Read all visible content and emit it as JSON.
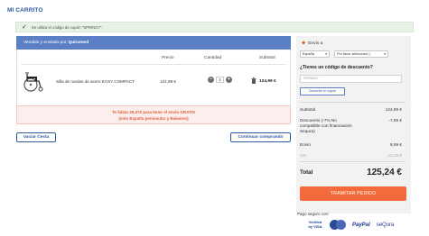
{
  "page": {
    "title": "MI CARRITO"
  },
  "alert": {
    "message": "Se utiliza el código de cupón \"SPRING7\"."
  },
  "cart": {
    "header_prefix": "Vendido y enviado por",
    "seller": "Quirumed",
    "columns": {
      "price": "Precio",
      "quantity": "Cantidad",
      "subtotal": "Subtotal"
    },
    "item": {
      "name": "Silla de ruedas de acero EASY COMPACT",
      "price": "124,99 €",
      "quantity": "1",
      "subtotal": "124,99 €"
    }
  },
  "promo": {
    "line1": "Te faltan 26,37€ para tener el envío GRATIS",
    "line2": "(solo España peninsular y Baleares)"
  },
  "actions": {
    "empty_cart": "Vaciar Cesta",
    "continue_shopping": "Continuar comprando"
  },
  "sidebar": {
    "ship_to": "Envío a",
    "country": "España",
    "region_placeholder": "Por favor seleccione (",
    "discount_question": "¿Tienes un código de descuento?",
    "coupon_value": "SPRING7",
    "cancel_coupon": "Cancelar el cupón",
    "subtotal_label": "Subtotal",
    "subtotal_value": "124,99 €",
    "discount_label": "Descuento (-7% No compatible con financiación Sequra)",
    "discount_value": "-7,95 €",
    "shipping_label": "Envío",
    "shipping_value": "8,99 €",
    "iva_label": "IVA",
    "iva_value": "12,15 €",
    "total_label": "Total",
    "total_value": "125,24 €",
    "checkout": "TRAMITAR PEDIDO"
  },
  "payment": {
    "secure_label": "Pago seguro con:",
    "verified_visa": "Verified by VISA",
    "paypal": "PayPal",
    "sequra": "seQura"
  },
  "colors": {
    "primary": "#2d5aa0",
    "header_bg": "#5b7fc4",
    "cta": "#f26b3a",
    "alert_bg": "#e8f2e6",
    "promo_text": "#e0603c"
  },
  "icons": [
    "check-icon",
    "wheelchair-image",
    "minus-icon",
    "plus-icon",
    "trash-icon",
    "location-pin-icon",
    "chevron-down-icon",
    "mastercard-icon"
  ]
}
